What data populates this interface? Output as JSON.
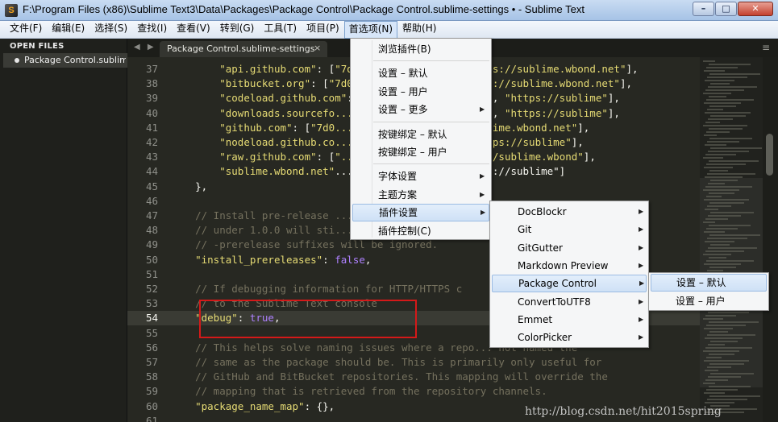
{
  "window": {
    "title": "F:\\Program Files (x86)\\Sublime Text3\\Data\\Packages\\Package Control\\Package Control.sublime-settings • - Sublime Text",
    "icon_glyph": "S"
  },
  "menubar": [
    {
      "label": "文件(F)"
    },
    {
      "label": "编辑(E)"
    },
    {
      "label": "选择(S)"
    },
    {
      "label": "查找(I)"
    },
    {
      "label": "查看(V)"
    },
    {
      "label": "转到(G)"
    },
    {
      "label": "工具(T)"
    },
    {
      "label": "项目(P)"
    },
    {
      "label": "首选项(N)",
      "active": true
    },
    {
      "label": "帮助(H)"
    }
  ],
  "sidebar": {
    "title": "OPEN FILES",
    "files": [
      "Package Control.sublime-settings"
    ]
  },
  "tabs": [
    {
      "label": "Package Control.sublime-settings",
      "close": "×"
    }
  ],
  "tab_arrows": "◀ ▶",
  "panel_menu": "≡",
  "editor": {
    "current_line": "54",
    "lines": [
      {
        "n": "37",
        "code": "        \"api.github.com\": [\"7d0b...3b1cf23850\", \"https://sublime.wbond.net\"],"
      },
      {
        "n": "38",
        "code": "        \"bitbucket.org\": [\"7d0b...3b1cf23850\", \"https://sublime.wbond.net\"],"
      },
      {
        "n": "39",
        "code": "        \"codeload.github.com\": [\"...8c02aa3b1cf23850\", \"https://sublime\"],"
      },
      {
        "n": "40",
        "code": "        \"downloads.sourcefo...ff70d71cea42361ae209d5\", \"https://sublime\"],"
      },
      {
        "n": "41",
        "code": "        \"github.com\": [\"7d0...cf23850\", \"https://sublime.wbond.net\"],"
      },
      {
        "n": "42",
        "code": "        \"nodeload.github.co...8c02aa3b1cf23850\", \"https://sublime\"],"
      },
      {
        "n": "43",
        "code": "        \"raw.github.com\": [\"...a3b1cf23850\", \"https://sublime.wbond\"],"
      },
      {
        "n": "44",
        "code": "        \"sublime.wbond.net\"...ea42361ae209d5\", \"https://sublime\"]"
      },
      {
        "n": "45",
        "code": "    },"
      },
      {
        "n": "46",
        "code": ""
      },
      {
        "n": "47",
        "code": "    // Install pre-release ... ns"
      },
      {
        "n": "48",
        "code": "    // under 1.0.0 will sti... r"
      },
      {
        "n": "49",
        "code": "    // -prerelease suffixes will be ignored."
      },
      {
        "n": "50",
        "code": "    \"install_prereleases\": false,"
      },
      {
        "n": "51",
        "code": ""
      },
      {
        "n": "52",
        "code": "    // If debugging information for HTTP/HTTPS c"
      },
      {
        "n": "53",
        "code": "    // to the Sublime Text console"
      },
      {
        "n": "54",
        "code": "    \"debug\": true,"
      },
      {
        "n": "55",
        "code": ""
      },
      {
        "n": "56",
        "code": "    // This helps solve naming issues where a repo... not named the"
      },
      {
        "n": "57",
        "code": "    // same as the package should be. This is primarily only useful for"
      },
      {
        "n": "58",
        "code": "    // GitHub and BitBucket repositories. This mapping will override the"
      },
      {
        "n": "59",
        "code": "    // mapping that is retrieved from the repository channels."
      },
      {
        "n": "60",
        "code": "    \"package_name_map\": {},"
      },
      {
        "n": "61",
        "code": ""
      }
    ]
  },
  "preferences_menu": {
    "items": [
      {
        "label": "浏览插件(B)"
      },
      {
        "separator": true
      },
      {
        "label": "设置 – 默认"
      },
      {
        "label": "设置 – 用户"
      },
      {
        "label": "设置 – 更多",
        "submenu": true
      },
      {
        "separator": true
      },
      {
        "label": "按键绑定 – 默认"
      },
      {
        "label": "按键绑定 – 用户"
      },
      {
        "separator": true
      },
      {
        "label": "字体设置",
        "submenu": true
      },
      {
        "label": "主题方案",
        "submenu": true
      },
      {
        "label": "插件设置",
        "submenu": true,
        "hover": true
      },
      {
        "label": "插件控制(C)"
      }
    ]
  },
  "plugin_settings_menu": {
    "items": [
      {
        "label": "DocBlockr",
        "submenu": true
      },
      {
        "label": "Git",
        "submenu": true
      },
      {
        "label": "GitGutter",
        "submenu": true
      },
      {
        "label": "Markdown Preview",
        "submenu": true
      },
      {
        "label": "Package Control",
        "submenu": true,
        "hover": true
      },
      {
        "label": "ConvertToUTF8",
        "submenu": true
      },
      {
        "label": "Emmet",
        "submenu": true
      },
      {
        "label": "ColorPicker",
        "submenu": true
      }
    ]
  },
  "package_control_menu": {
    "items": [
      {
        "label": "设置 – 默认",
        "hover": true
      },
      {
        "label": "设置 – 用户"
      }
    ]
  },
  "watermark": "http://blog.csdn.net/hit2015spring",
  "colors": {
    "editor_bg": "#272822",
    "string": "#e6db74",
    "keyword": "#ae81ff",
    "comment": "#75715e",
    "annotation_box": "#d41919"
  },
  "icons": {
    "minimize": "minimize-icon",
    "maximize": "maximize-icon",
    "close": "close-icon",
    "submenu": "submenu-arrow-icon"
  }
}
